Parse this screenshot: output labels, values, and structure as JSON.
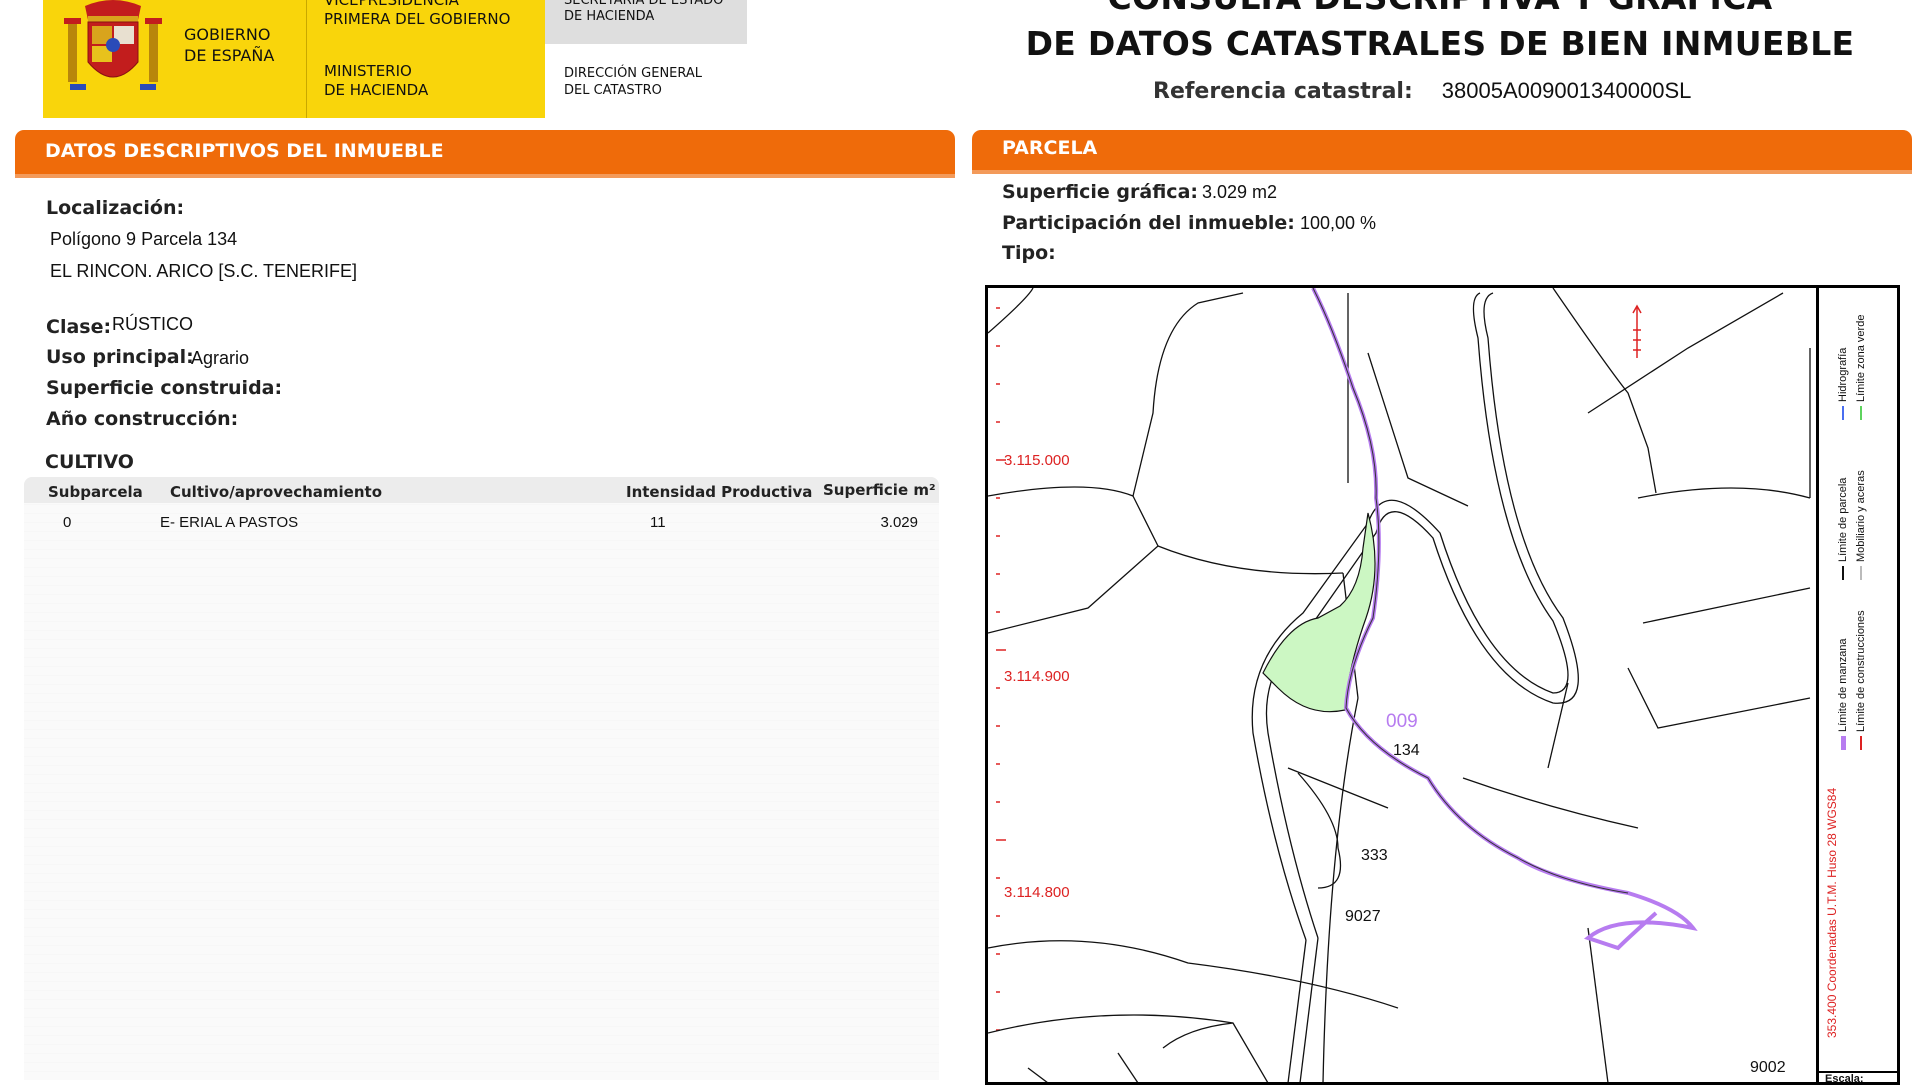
{
  "header": {
    "gov_logo_line1": "GOBIERNO",
    "gov_logo_line2": "DE ESPAÑA",
    "vice_line1": "VICEPRESIDENCIA",
    "vice_line2": "PRIMERA DEL GOBIERNO",
    "ministry_line1": "MINISTERIO",
    "ministry_line2": "DE HACIENDA",
    "secretary_line1": "SECRETARÍA DE ESTADO",
    "secretary_line2": "DE HACIENDA",
    "directorate_line1": "DIRECCIÓN GENERAL",
    "directorate_line2": "DEL CATASTRO",
    "title_line1": "CONSULTA DESCRIPTIVA Y GRÁFICA",
    "title_line2": "DE DATOS CATASTRALES DE BIEN INMUEBLE",
    "ref_label": "Referencia catastral:",
    "ref_value": "38005A009001340000SL",
    "brand_yellow": "#f9d50b",
    "brand_orange": "#ef6b0a"
  },
  "left_panel": {
    "title": "DATOS DESCRIPTIVOS DEL INMUEBLE",
    "localizacion_label": "Localización:",
    "localizacion_line1": "Polígono 9 Parcela 134",
    "localizacion_line2": "EL RINCON. ARICO [S.C. TENERIFE]",
    "clase_label": "Clase:",
    "clase_value": "RÚSTICO",
    "uso_label": "Uso principal:",
    "uso_value": "Agrario",
    "sup_construida_label": "Superficie construida:",
    "anio_label": "Año construcción:",
    "cultivo_title": "CULTIVO",
    "table_headers": {
      "subparcela": "Subparcela",
      "cultivo": "Cultivo/aprovechamiento",
      "intensidad": "Intensidad Productiva",
      "superficie": "Superficie m²"
    },
    "rows": [
      {
        "subparcela": "0",
        "cultivo": "E- ERIAL A PASTOS",
        "intensidad": "11",
        "superficie": "3.029"
      }
    ]
  },
  "right_panel": {
    "title": "PARCELA",
    "sup_grafica_label": "Superficie gráfica:",
    "sup_grafica_value": "3.029 m2",
    "participacion_label": "Participación del inmueble:",
    "participacion_value": "100,00 %",
    "tipo_label": "Tipo:",
    "map": {
      "coord_y1": "3.115.000",
      "coord_y2": "3.114.900",
      "coord_y3": "3.114.800",
      "parcel_poligono": "009",
      "parcel_number": "134",
      "label_333": "333",
      "label_9027": "9027",
      "label_9002": "9002",
      "legend_coords": "353.400 Coordenadas U.T.M. Huso 28 WGS84",
      "legend_manzana": "Límite de manzana",
      "legend_construcciones": "Límite de construcciones",
      "legend_parcela": "Límite de parcela",
      "legend_mobiliario": "Mobiliario y aceras",
      "legend_hidrografia": "Hidrografía",
      "legend_zona_verde": "Límite zona verde",
      "escala": "Escala:"
    }
  }
}
